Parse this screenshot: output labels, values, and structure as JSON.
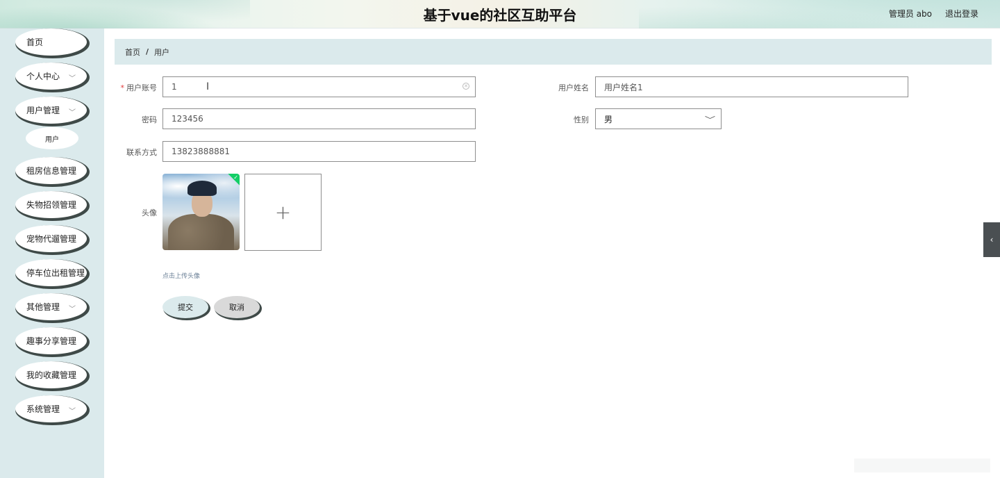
{
  "header": {
    "title": "基于vue的社区互助平台",
    "user": "管理员 abo",
    "logout": "退出登录"
  },
  "sidebar": {
    "items": [
      {
        "label": "首页",
        "has_children": false
      },
      {
        "label": "个人中心",
        "has_children": true
      },
      {
        "label": "用户管理",
        "has_children": true
      },
      {
        "label": "租房信息管理",
        "has_children": false
      },
      {
        "label": "失物招领管理",
        "has_children": false
      },
      {
        "label": "宠物代遛管理",
        "has_children": false
      },
      {
        "label": "停车位出租管理",
        "has_children": false
      },
      {
        "label": "其他管理",
        "has_children": true
      },
      {
        "label": "趣事分享管理",
        "has_children": false
      },
      {
        "label": "我的收藏管理",
        "has_children": false
      },
      {
        "label": "系统管理",
        "has_children": true
      }
    ],
    "submenu": {
      "label": "用户"
    }
  },
  "breadcrumb": {
    "home": "首页",
    "separator": "/",
    "current": "用户"
  },
  "form": {
    "account": {
      "label": "用户账号",
      "value": "1",
      "required": true
    },
    "name": {
      "label": "用户姓名",
      "value": "用户姓名1"
    },
    "password": {
      "label": "密码",
      "value": "123456"
    },
    "gender": {
      "label": "性别",
      "value": "男"
    },
    "phone": {
      "label": "联系方式",
      "value": "13823888881"
    },
    "avatar": {
      "label": "头像",
      "upload_tip": "点击上传头像",
      "add_icon": "+"
    },
    "submit_label": "提交",
    "cancel_label": "取消"
  },
  "icons": {
    "chevron": "﹀",
    "side_toggle": "‹"
  },
  "colors": {
    "accent": "#dbeaec",
    "shadow": "#3f4a48",
    "success": "#13ce66"
  }
}
